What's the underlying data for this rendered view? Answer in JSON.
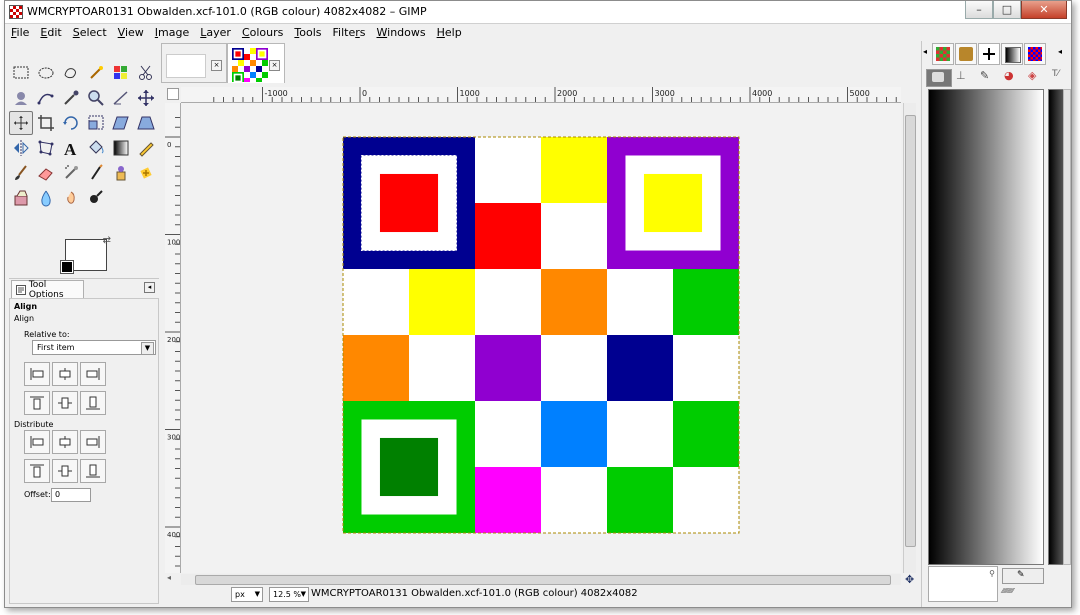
{
  "window": {
    "title": "WMCRYPTOAR0131 Obwalden.xcf-101.0 (RGB colour) 4082x4082 – GIMP",
    "minimize": "–",
    "maximize": "□",
    "close": "✕"
  },
  "menu": [
    {
      "label": "File",
      "key": "F",
      "rest": "ile"
    },
    {
      "label": "Edit",
      "key": "E",
      "rest": "dit"
    },
    {
      "label": "Select",
      "key": "S",
      "rest": "elect"
    },
    {
      "label": "View",
      "key": "V",
      "rest": "iew"
    },
    {
      "label": "Image",
      "key": "I",
      "rest": "mage"
    },
    {
      "label": "Layer",
      "key": "L",
      "rest": "ayer"
    },
    {
      "label": "Colours",
      "key": "C",
      "rest": "olours"
    },
    {
      "label": "Tools",
      "key": "T",
      "rest": "ools"
    },
    {
      "label": "Filters",
      "key": "r",
      "pre": "Filte",
      "rest": "s"
    },
    {
      "label": "Windows",
      "key": "W",
      "rest": "indows"
    },
    {
      "label": "Help",
      "key": "H",
      "rest": "elp"
    }
  ],
  "tools": [
    "rect-select",
    "ellipse-select",
    "free-select",
    "fuzzy-select",
    "select-by-color",
    "scissors",
    "foreground-select",
    "paths",
    "color-picker",
    "zoom",
    "measure",
    "move",
    "align",
    "crop",
    "rotate",
    "scale",
    "shear",
    "perspective",
    "flip",
    "cage",
    "text",
    "bucket-fill",
    "blend",
    "pencil",
    "paintbrush",
    "eraser",
    "airbrush",
    "ink",
    "clone",
    "heal",
    "perspective-clone",
    "blur",
    "smudge",
    "dodge-burn"
  ],
  "tool_options": {
    "tab_label": "Tool Options",
    "title": "Align",
    "subtitle": "Align",
    "relative_to_label": "Relative to:",
    "relative_to_value": "First item",
    "distribute_label": "Distribute",
    "offset_label": "Offset:",
    "offset_value": "0"
  },
  "ruler": {
    "labels": [
      "-1000",
      "0",
      "1000",
      "2000",
      "3000",
      "4000",
      "5000"
    ],
    "v_labels": [
      "0",
      "1000",
      "2000",
      "3000",
      "4000"
    ]
  },
  "image_grid": {
    "colors": {
      "navy": "#000090",
      "red": "#ff0000",
      "yellow": "#ffff00",
      "purple": "#9000d0",
      "orange": "#ff8800",
      "green": "#00cc00",
      "darkgreen": "#008000",
      "blue": "#0080ff",
      "magenta": "#ff00ff",
      "white": "#ffffff"
    },
    "cells": [
      [
        "navy",
        "navy",
        "white",
        "yellow",
        "purple",
        "purple"
      ],
      [
        "navy",
        "navy",
        "red",
        "white",
        "purple",
        "purple"
      ],
      [
        "white",
        "yellow",
        "white",
        "orange",
        "white",
        "green"
      ],
      [
        "orange",
        "white",
        "purple",
        "white",
        "navy",
        "white"
      ],
      [
        "green",
        "green",
        "white",
        "blue",
        "white",
        "green"
      ],
      [
        "green",
        "green",
        "magenta",
        "white",
        "green",
        "white"
      ]
    ]
  },
  "status": {
    "unit": "px",
    "zoom": "12.5 %",
    "text": "WMCRYPTOAR0131 Obwalden.xcf-101.0 (RGB colour) 4082x4082"
  }
}
